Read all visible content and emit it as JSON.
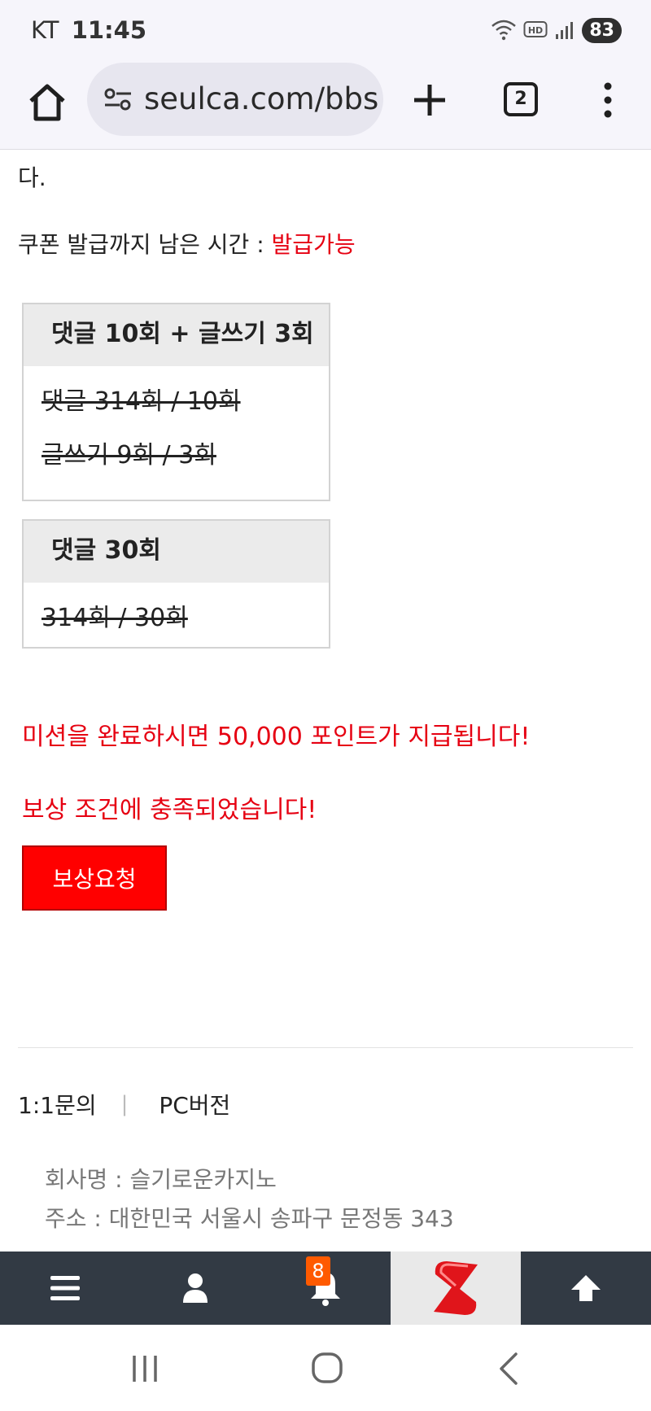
{
  "status_bar": {
    "carrier": "KT",
    "time": "11:45",
    "battery": "83",
    "icons": [
      "wifi-icon",
      "hd-voice-icon",
      "signal-icon"
    ]
  },
  "browser": {
    "url": "seulca.com/bbs",
    "tab_count": "2",
    "icons": [
      "home-icon",
      "site-settings-icon",
      "new-tab-icon",
      "tabs-icon",
      "more-vert-icon"
    ]
  },
  "page": {
    "top_fragment": "다.",
    "coupon_label": "쿠폰 발급까지 남은 시간 : ",
    "coupon_status": "발급가능",
    "missions": [
      {
        "title": "댓글 10회 + 글쓰기 3회",
        "lines": [
          "댓글 314회 / 10회",
          "글쓰기 9회 / 3회"
        ]
      },
      {
        "title": "댓글 30회",
        "lines": [
          "314회 / 30회"
        ]
      }
    ],
    "reward_message": "미션을 완료하시면 50,000 포인트가 지급됩니다!",
    "condition_message": "보상 조건에 충족되었습니다!",
    "reward_button": "보상요청"
  },
  "footer": {
    "links": [
      "1:1문의",
      "PC버전"
    ],
    "separator": "|",
    "company_name": "회사명 : 슬기로운카지노",
    "address": "주소 : 대한민국 서울시 송파구 문정동 343"
  },
  "bottom_nav": {
    "notification_count": "8",
    "items": [
      "menu-icon",
      "user-icon",
      "bell-icon",
      "site-logo",
      "scroll-top-icon"
    ]
  },
  "colors": {
    "accent_red": "#e60012",
    "button_red": "#ff0000",
    "nav_bg": "#323a44",
    "badge_orange": "#ff5a00",
    "browser_bg": "#f6f5fb"
  }
}
